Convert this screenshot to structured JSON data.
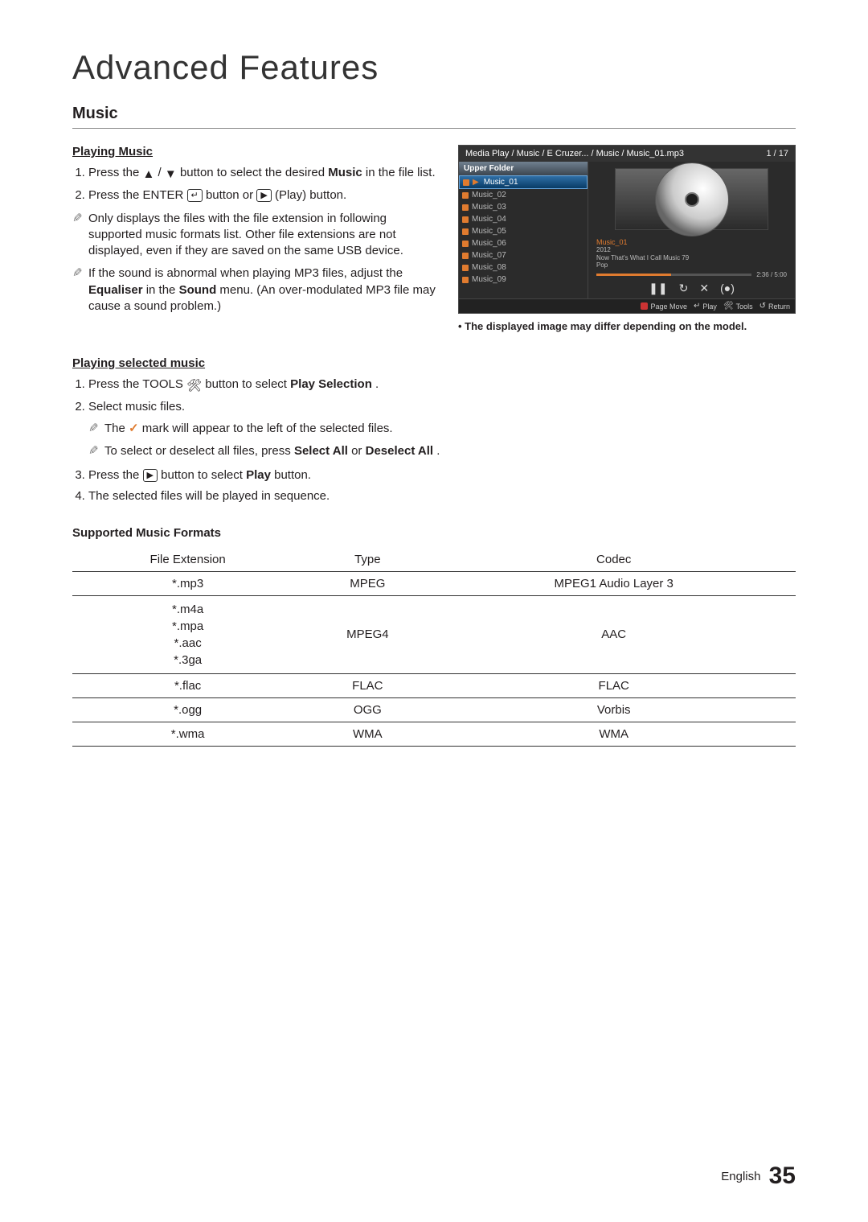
{
  "header": {
    "main_title": "Advanced Features"
  },
  "section": {
    "title": "Music"
  },
  "playing_music": {
    "heading": "Playing Music",
    "step1_a": "Press the ",
    "step1_b": " button to select the desired ",
    "step1_bold": "Music",
    "step1_c": " in the file list.",
    "step2_a": "Press the ENTER",
    "step2_b": " button or ",
    "step2_c": " (Play) button.",
    "note1": "Only displays the files with the file extension in following supported music formats list. Other file extensions are not displayed, even if they are saved on the same USB device.",
    "note2_a": "If the sound is abnormal when playing MP3 files, adjust the ",
    "note2_b1": "Equaliser",
    "note2_mid": " in the ",
    "note2_b2": "Sound",
    "note2_c": " menu. (An over-modulated MP3 file may cause a sound problem.)"
  },
  "playing_selected": {
    "heading": "Playing selected music",
    "step1_a": "Press the TOOLS",
    "step1_b": " button to select ",
    "step1_bold": "Play Selection",
    "step1_c": ".",
    "step2": "Select music files.",
    "sub1_a": "The ",
    "sub1_b": " mark will appear to the left of the selected files.",
    "sub2_a": "To select or deselect all files, press ",
    "sub2_b1": "Select All",
    "sub2_mid": " or ",
    "sub2_b2": "Deselect All",
    "sub2_c": ".",
    "step3_a": "Press the ",
    "step3_b": " button to select ",
    "step3_bold": "Play",
    "step3_c": " button.",
    "step4": "The selected files will be played in sequence."
  },
  "formats": {
    "heading": "Supported Music Formats",
    "headers": {
      "ext": "File Extension",
      "type": "Type",
      "codec": "Codec"
    },
    "rows": [
      {
        "ext": "*.mp3",
        "type": "MPEG",
        "codec": "MPEG1 Audio Layer 3"
      },
      {
        "ext": "*.m4a\n*.mpa\n*.aac\n*.3ga",
        "type": "MPEG4",
        "codec": "AAC"
      },
      {
        "ext": "*.flac",
        "type": "FLAC",
        "codec": "FLAC"
      },
      {
        "ext": "*.ogg",
        "type": "OGG",
        "codec": "Vorbis"
      },
      {
        "ext": "*.wma",
        "type": "WMA",
        "codec": "WMA"
      }
    ]
  },
  "media_mock": {
    "breadcrumb": "Media Play / Music / E   Cruzer... / Music / Music_01.mp3",
    "count": "1 / 17",
    "upper": "Upper Folder",
    "items": [
      "Music_01",
      "Music_02",
      "Music_03",
      "Music_04",
      "Music_05",
      "Music_06",
      "Music_07",
      "Music_08",
      "Music_09"
    ],
    "now_title": "Music_01",
    "meta1": "2012",
    "meta2": "Now That's What I Call Music 79",
    "meta3": "Pop",
    "time": "2:36 / 5:00",
    "footer": {
      "page_move": "Page Move",
      "play": "Play",
      "tools": "Tools",
      "return": "Return"
    }
  },
  "caption": "The displayed image may differ depending on the model.",
  "footer": {
    "lang": "English",
    "page": "35"
  }
}
